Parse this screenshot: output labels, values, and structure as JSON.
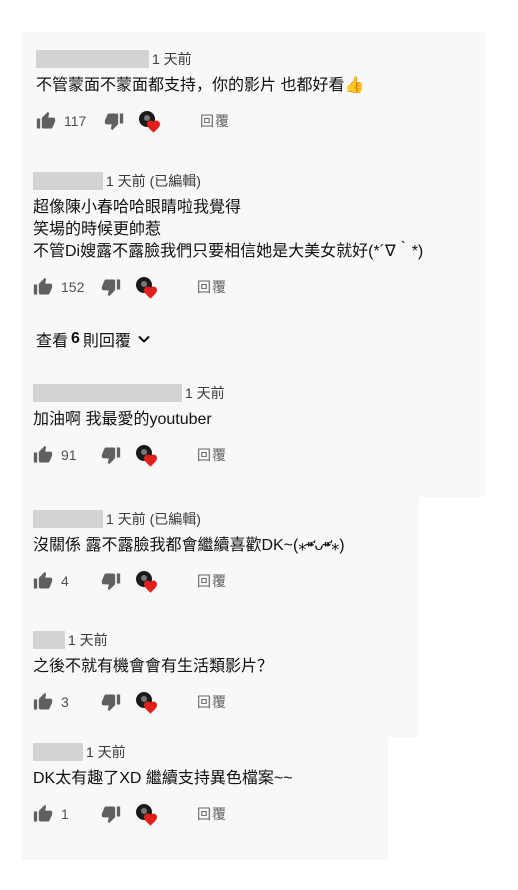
{
  "comments": [
    {
      "timestamp": "1 天前",
      "lines": [
        "不管蒙面不蒙面都支持，你的影片 也都好看👍"
      ],
      "likes": "117",
      "reply_label": "回覆"
    },
    {
      "timestamp": "1 天前 (已編輯)",
      "lines": [
        "超像陳小春哈哈眼睛啦我覺得",
        "笑場的時候更帥惹",
        "不管Di嫂露不露臉我們只要相信她是大美女就好(*´∇｀*)"
      ],
      "likes": "152",
      "reply_label": "回覆"
    },
    {
      "timestamp": "1 天前",
      "lines": [
        "加油啊 我最愛的youtuber"
      ],
      "likes": "91",
      "reply_label": "回覆"
    },
    {
      "timestamp": "1 天前 (已編輯)",
      "lines": [
        "沒關係 露不露臉我都會繼續喜歡DK~(⁎⁍̴̛ᴗ⁍̴̛⁎)"
      ],
      "likes": "4",
      "reply_label": "回覆"
    },
    {
      "timestamp": "1 天前",
      "lines": [
        "之後不就有機會會有生活類影片？"
      ],
      "likes": "3",
      "reply_label": "回覆"
    },
    {
      "timestamp": "1 天前",
      "lines": [
        "DK太有趣了XD 繼續支持異色檔案~~"
      ],
      "likes": "1",
      "reply_label": "回覆"
    }
  ],
  "view_replies": {
    "prefix": "查看",
    "count": "6",
    "suffix": "則回覆"
  },
  "colors": {
    "heart": "#e0201c",
    "avatar": "#1a1a1a",
    "icon": "#606060",
    "panel": "#f8f8f8"
  }
}
